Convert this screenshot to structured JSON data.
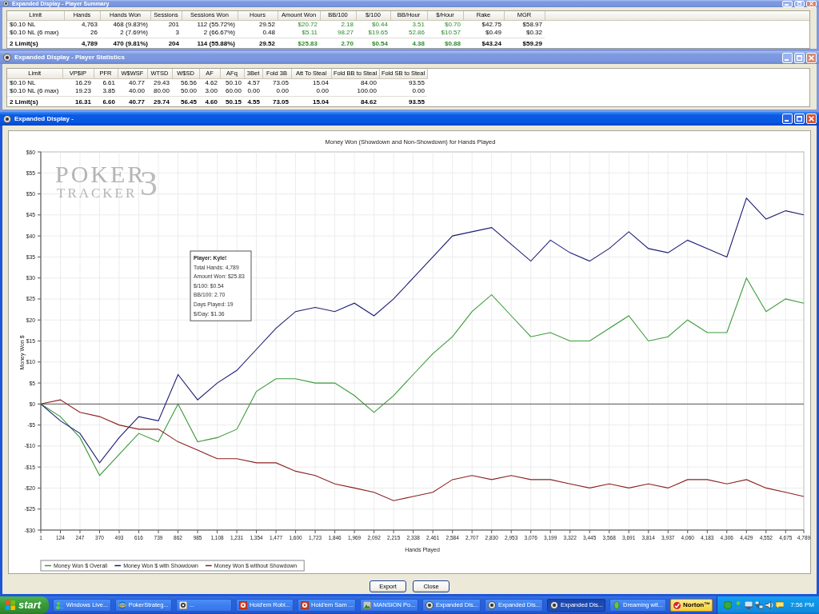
{
  "summary_window": {
    "title": "Expanded Display - Player Summary",
    "active": false,
    "table": {
      "columns": [
        {
          "label": "Limit",
          "kind": "text"
        },
        {
          "label": "Hands",
          "kind": "number"
        },
        {
          "label": "Hands Won",
          "kind": "number"
        },
        {
          "label": "Sessions",
          "kind": "number"
        },
        {
          "label": "Sessions Won",
          "kind": "number"
        },
        {
          "label": "Hours",
          "kind": "number"
        },
        {
          "label": "Amount Won",
          "kind": "result"
        },
        {
          "label": "BB/100",
          "kind": "result"
        },
        {
          "label": "$/100",
          "kind": "result"
        },
        {
          "label": "BB/Hour",
          "kind": "result"
        },
        {
          "label": "$/Hour",
          "kind": "result"
        },
        {
          "label": "Rake",
          "kind": "number"
        },
        {
          "label": "MGR",
          "kind": "number"
        }
      ],
      "rows": [
        {
          "kind": "limit",
          "cells": [
            "$0.10 NL",
            "4,763",
            "468 (9.83%)",
            "201",
            "112 (55.72%)",
            "29.52",
            "$20.72",
            "2.18",
            "$0.44",
            "3.51",
            "$0.70",
            "$42.75",
            "$58.97"
          ]
        },
        {
          "kind": "limit",
          "cells": [
            "$0.10 NL (6 max)",
            "26",
            "2 (7.69%)",
            "3",
            "2 (66.67%)",
            "0.48",
            "$5.11",
            "98.27",
            "$19.65",
            "52.86",
            "$10.57",
            "$0.49",
            "$0.32"
          ]
        },
        {
          "kind": "total",
          "cells": [
            "2 Limit(s)",
            "4,789",
            "470 (9.81%)",
            "204",
            "114 (55.88%)",
            "29.52",
            "$25.83",
            "2.70",
            "$0.54",
            "4.38",
            "$0.88",
            "$43.24",
            "$59.29"
          ]
        }
      ]
    }
  },
  "statistics_window": {
    "title": "Expanded Display - Player Statistics",
    "active": false,
    "table": {
      "columns": [
        {
          "label": "Limit",
          "kind": "text"
        },
        {
          "label": "VP$IP",
          "kind": "number"
        },
        {
          "label": "PFR",
          "kind": "number"
        },
        {
          "label": "W$WSF",
          "kind": "number"
        },
        {
          "label": "WTSD",
          "kind": "number"
        },
        {
          "label": "W$SD",
          "kind": "number"
        },
        {
          "label": "AF",
          "kind": "number"
        },
        {
          "label": "AFq",
          "kind": "number"
        },
        {
          "label": "3Bet",
          "kind": "number"
        },
        {
          "label": "Fold 3B",
          "kind": "number"
        },
        {
          "label": "Att To Steal",
          "kind": "number"
        },
        {
          "label": "Fold BB to Steal",
          "kind": "number"
        },
        {
          "label": "Fold SB to Steal",
          "kind": "number"
        }
      ],
      "rows": [
        {
          "kind": "limit",
          "cells": [
            "$0.10 NL",
            "16.29",
            "6.61",
            "40.77",
            "29.43",
            "56.56",
            "4.62",
            "50.10",
            "4.57",
            "73.05",
            "15.04",
            "84.00",
            "93.55"
          ]
        },
        {
          "kind": "limit",
          "cells": [
            "$0.10 NL (6 max)",
            "19.23",
            "3.85",
            "40.00",
            "80.00",
            "50.00",
            "3.00",
            "60.00",
            "0.00",
            "0.00",
            "0.00",
            "100.00",
            "0.00"
          ]
        },
        {
          "kind": "total",
          "cells": [
            "2 Limit(s)",
            "16.31",
            "6.60",
            "40.77",
            "29.74",
            "56.45",
            "4.60",
            "50.15",
            "4.55",
            "73.05",
            "15.04",
            "84.62",
            "93.55"
          ]
        }
      ]
    }
  },
  "chart_window": {
    "title": "Expanded Display -",
    "active": true,
    "logo": {
      "wordmark": "POKER",
      "subtitle": "TRACKER",
      "version": "3"
    },
    "chart_data": {
      "type": "line",
      "title": "Money Won (Showdown and Non-Showdown) for Hands Played",
      "xlabel": "Hands Played",
      "ylabel": "Money Won $",
      "x": [
        1,
        124,
        247,
        370,
        493,
        616,
        739,
        862,
        985,
        1108,
        1231,
        1354,
        1477,
        1600,
        1723,
        1846,
        1969,
        2092,
        2215,
        2338,
        2461,
        2584,
        2707,
        2830,
        2953,
        3076,
        3199,
        3322,
        3445,
        3568,
        3691,
        3814,
        3937,
        4060,
        4183,
        4306,
        4429,
        4552,
        4675,
        4789
      ],
      "series": [
        {
          "name": "Money Won $ Overall",
          "color": "#3a9a3a",
          "values": [
            0,
            -3,
            -8,
            -17,
            -12,
            -7,
            -9,
            0,
            -9,
            -8,
            -6,
            3,
            6,
            6,
            5,
            5,
            2,
            -2,
            2,
            7,
            12,
            16,
            22,
            26,
            21,
            16,
            17,
            15,
            15,
            18,
            21,
            15,
            16,
            20,
            17,
            17,
            30,
            22,
            25,
            24
          ]
        },
        {
          "name": "Money Won $ with Showdown",
          "color": "#1c1c72",
          "values": [
            0,
            -4,
            -7,
            -14,
            -8,
            -3,
            -4,
            7,
            1,
            5,
            8,
            13,
            18,
            22,
            23,
            22,
            24,
            21,
            25,
            30,
            35,
            40,
            41,
            42,
            38,
            34,
            39,
            36,
            34,
            37,
            41,
            37,
            36,
            39,
            37,
            35,
            49,
            44,
            46,
            45
          ]
        },
        {
          "name": "Money Won $ without Showdown",
          "color": "#8b2020",
          "values": [
            0,
            1,
            -2,
            -3,
            -5,
            -6,
            -6,
            -9,
            -11,
            -13,
            -13,
            -14,
            -14,
            -16,
            -17,
            -19,
            -20,
            -21,
            -23,
            -22,
            -21,
            -18,
            -17,
            -18,
            -17,
            -18,
            -18,
            -19,
            -20,
            -19,
            -20,
            -19,
            -20,
            -18,
            -18,
            -19,
            -18,
            -20,
            -21,
            -22
          ]
        }
      ],
      "xlim": [
        1,
        4789
      ],
      "ylim": [
        -30,
        60
      ],
      "grid": true,
      "legend": "bottom",
      "xticks": [
        1,
        124,
        247,
        370,
        493,
        616,
        739,
        862,
        985,
        {
          "value": 1108,
          "label": "1,108"
        },
        {
          "value": 1231,
          "label": "1,231"
        },
        {
          "value": 1354,
          "label": "1,354"
        },
        {
          "value": 1477,
          "label": "1,477"
        },
        {
          "value": 1600,
          "label": "1,600"
        },
        {
          "value": 1723,
          "label": "1,723"
        },
        {
          "value": 1846,
          "label": "1,846"
        },
        {
          "value": 1969,
          "label": "1,969"
        },
        {
          "value": 2092,
          "label": "2,092"
        },
        {
          "value": 2215,
          "label": "2,215"
        },
        {
          "value": 2338,
          "label": "2,338"
        },
        {
          "value": 2461,
          "label": "2,461"
        },
        {
          "value": 2584,
          "label": "2,584"
        },
        {
          "value": 2707,
          "label": "2,707"
        },
        {
          "value": 2830,
          "label": "2,830"
        },
        {
          "value": 2953,
          "label": "2,953"
        },
        {
          "value": 3076,
          "label": "3,076"
        },
        {
          "value": 3199,
          "label": "3,199"
        },
        {
          "value": 3322,
          "label": "3,322"
        },
        {
          "value": 3445,
          "label": "3,445"
        },
        {
          "value": 3568,
          "label": "3,568"
        },
        {
          "value": 3691,
          "label": "3,691"
        },
        {
          "value": 3814,
          "label": "3,814"
        },
        {
          "value": 3937,
          "label": "3,937"
        },
        {
          "value": 4060,
          "label": "4,060"
        },
        {
          "value": 4183,
          "label": "4,183"
        },
        {
          "value": 4306,
          "label": "4,306"
        },
        {
          "value": 4429,
          "label": "4,429"
        },
        {
          "value": 4552,
          "label": "4,552"
        },
        {
          "value": 4675,
          "label": "4,675"
        },
        {
          "value": 4789,
          "label": "4,789"
        }
      ],
      "yticks": [
        {
          "value": 60,
          "label": "$60"
        },
        {
          "value": 55,
          "label": "$55"
        },
        {
          "value": 50,
          "label": "$50"
        },
        {
          "value": 45,
          "label": "$45"
        },
        {
          "value": 40,
          "label": "$40"
        },
        {
          "value": 35,
          "label": "$35"
        },
        {
          "value": 30,
          "label": "$30"
        },
        {
          "value": 25,
          "label": "$25"
        },
        {
          "value": 20,
          "label": "$20"
        },
        {
          "value": 15,
          "label": "$15"
        },
        {
          "value": 10,
          "label": "$10"
        },
        {
          "value": 5,
          "label": "$5"
        },
        {
          "value": 0,
          "label": "$0"
        },
        {
          "value": -5,
          "label": "-$5"
        },
        {
          "value": -10,
          "label": "-$10"
        },
        {
          "value": -15,
          "label": "-$15"
        },
        {
          "value": -20,
          "label": "-$20"
        },
        {
          "value": -25,
          "label": "-$25"
        },
        {
          "value": -30,
          "label": "-$30"
        }
      ]
    },
    "tooltip": {
      "title": "Player: Kyle!",
      "lines": [
        "Total Hands: 4,789",
        "Amount Won: $25.83",
        "$/100: $0.54",
        "BB/100: 2.70",
        "Days Played: 19",
        "$/Day: $1.36"
      ]
    },
    "buttons": [
      "Export",
      "Close"
    ]
  },
  "taskbar": {
    "start": "start",
    "items": [
      {
        "label": "Windows Live...",
        "kind": "messenger",
        "selected": false
      },
      {
        "label": "PokerStrateg...",
        "kind": "browser",
        "selected": false
      },
      {
        "label": "...",
        "kind": "poker",
        "selected": false
      },
      {
        "label": "Hold'em Robi...",
        "kind": "holdem",
        "selected": false
      },
      {
        "label": "Hold'em Sam ...",
        "kind": "holdem",
        "selected": false
      },
      {
        "label": "MANSION Po...",
        "kind": "mansion",
        "selected": false
      },
      {
        "label": "Expanded Dis...",
        "kind": "tracker",
        "selected": false
      },
      {
        "label": "Expanded Dis...",
        "kind": "tracker",
        "selected": false
      },
      {
        "label": "Expanded Dis...",
        "kind": "tracker",
        "selected": true
      },
      {
        "label": "Dreaming wit...",
        "kind": "media",
        "selected": false
      }
    ],
    "norton": "Norton™",
    "clock": "7:56 PM"
  }
}
